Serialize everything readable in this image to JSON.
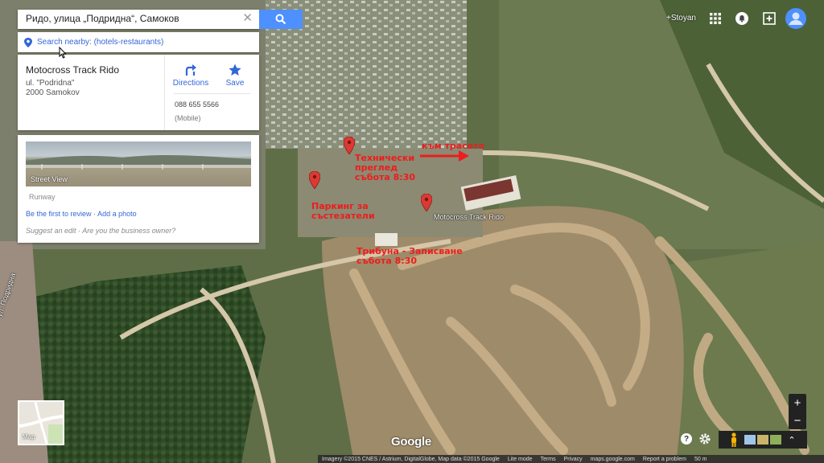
{
  "search": {
    "value": "Ридо, улица „Подридна“, Самоков",
    "search_icon": "search-icon"
  },
  "nearby": {
    "label": "Search nearby: (hotels-restaurants)"
  },
  "place": {
    "name": "Motocross Track Rido",
    "address_line1": "ul. \"Podridna\"",
    "address_line2": "2000 Samokov",
    "directions_label": "Directions",
    "save_label": "Save",
    "phone": "088 655 5566",
    "phone_type": "(Mobile)"
  },
  "streetview": {
    "label": "Street View",
    "category": "Runway",
    "review_link": "Be the first to review",
    "separator": "·",
    "photo_link": "Add a photo",
    "suggest": "Suggest an edit · Are you the business owner?"
  },
  "topbar": {
    "user": "+Stoyan"
  },
  "map_labels": {
    "pin1_text": "Технически\nпреглед\nсъбота 8:30",
    "arrow_text": "към трасето",
    "pin2_text": "Паркинг за\nсъстезатели",
    "pin3_text": "Motocross Track Rido",
    "tribune_text": "Трибуна - Записване\nсъбота 8:30",
    "street_name": "ул. Подридна"
  },
  "controls": {
    "zoom_in": "+",
    "zoom_out": "−",
    "map_thumb_label": "Map",
    "expand": "⌃",
    "help": "?"
  },
  "footer": {
    "imagery": "Imagery ©2015 CNES / Astrium, DigitalGlobe, Map data ©2015 Google",
    "lite_mode": "Lite mode",
    "terms": "Terms",
    "privacy": "Privacy",
    "site": "maps.google.com",
    "report": "Report a problem",
    "scale": "50 m"
  },
  "google_logo": "Google",
  "colors": {
    "pin_red": "#db3a34",
    "label_red": "#ee1c1c",
    "search_blue": "#4d90fe",
    "link_blue": "#3367d6"
  }
}
